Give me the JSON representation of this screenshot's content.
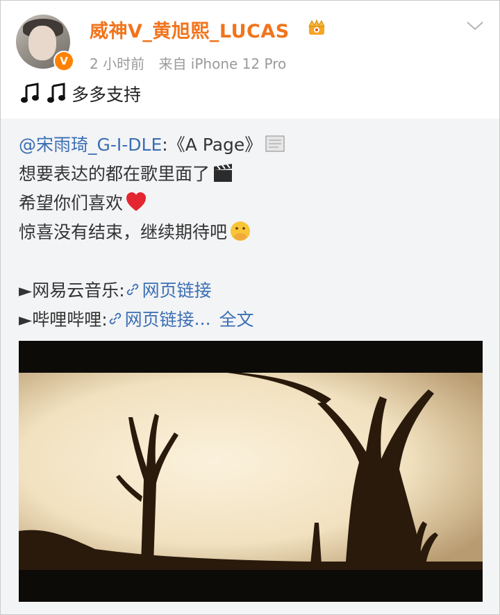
{
  "post": {
    "username": "威神V_黄旭熙_LUCAS",
    "verified_badge": "V",
    "time": "2 小时前",
    "source": "来自 iPhone 12 Pro",
    "text": "多多支持",
    "icons": [
      "crown-icon",
      "music-note-icon",
      "chevron-down-icon"
    ]
  },
  "repost": {
    "mention": "@宋雨琦_G-I-DLE",
    "title": ":《A Page》",
    "line2": "想要表达的都在歌里面了",
    "line3": "希望你们喜欢",
    "line4": "惊喜没有结束，继续期待吧",
    "netease_label": "►网易云音乐: ",
    "netease_link": "网页链接",
    "bilibili_label": "►哔哩哔哩:",
    "bilibili_link": "网页链接",
    "ellipsis": "...",
    "full_text": "全文"
  },
  "colors": {
    "username": "#f1741c",
    "link": "#3b6eb3",
    "badge": "#ff8200"
  }
}
